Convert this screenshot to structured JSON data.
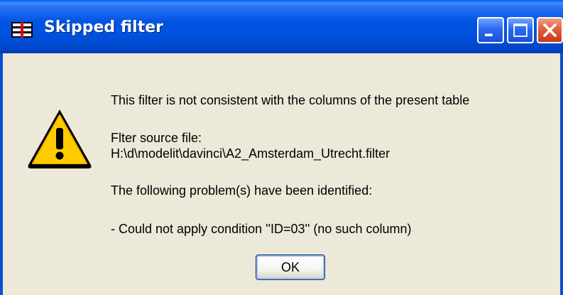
{
  "window": {
    "title": "Skipped filter",
    "controls": {
      "minimize_icon": "minimize-icon",
      "maximize_icon": "maximize-icon",
      "close_icon": "close-icon"
    }
  },
  "dialog": {
    "icon": "warning-icon",
    "message_line": "This filter is not consistent with the columns of the present table",
    "source_label": "Flter source file:",
    "source_path": "H:\\d\\modelit\\davinci\\A2_Amsterdam_Utrecht.filter",
    "problems_heading": "The following problem(s) have been identified:",
    "problem_item": "- Could not apply condition ''ID=03'' (no such column)",
    "ok_label": "OK"
  },
  "colors": {
    "titlebar": "#0055e5",
    "dialog_bg": "#ece9d8",
    "close_button": "#e0603f",
    "warning_fill": "#ffcc00"
  }
}
